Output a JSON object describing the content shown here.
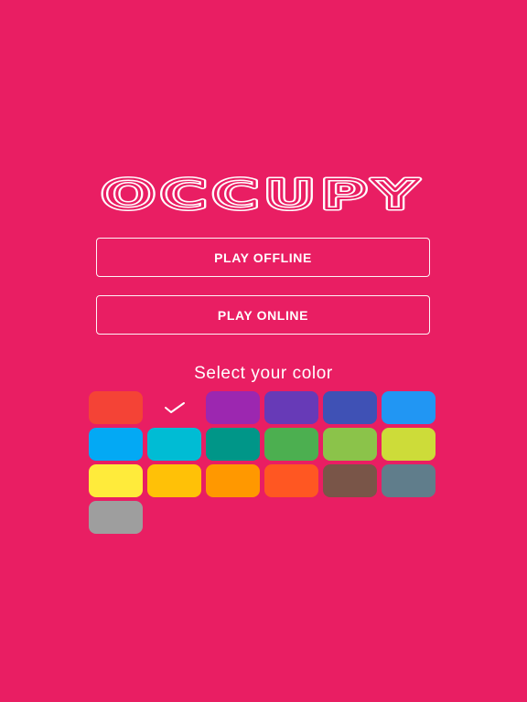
{
  "app": {
    "title": "OCCUPY",
    "background_color": "#E91E63"
  },
  "menu": {
    "play_offline_label": "PLAY OFFLINE",
    "play_online_label": "PLAY ONLINE"
  },
  "color_picker": {
    "label": "Select your color",
    "selected_index": 1,
    "selected_icon": "check-icon",
    "swatches": [
      {
        "name": "red",
        "color": "#F44336"
      },
      {
        "name": "pink",
        "color": "#E91E63"
      },
      {
        "name": "purple",
        "color": "#9C27B0"
      },
      {
        "name": "deep-purple",
        "color": "#673AB7"
      },
      {
        "name": "indigo",
        "color": "#3F51B5"
      },
      {
        "name": "blue",
        "color": "#2196F3"
      },
      {
        "name": "light-blue",
        "color": "#03A9F4"
      },
      {
        "name": "cyan",
        "color": "#00BCD4"
      },
      {
        "name": "teal",
        "color": "#009688"
      },
      {
        "name": "green",
        "color": "#4CAF50"
      },
      {
        "name": "light-green",
        "color": "#8BC34A"
      },
      {
        "name": "lime",
        "color": "#CDDC39"
      },
      {
        "name": "yellow",
        "color": "#FFEB3B"
      },
      {
        "name": "amber",
        "color": "#FFC107"
      },
      {
        "name": "orange",
        "color": "#FF9800"
      },
      {
        "name": "deep-orange",
        "color": "#FF5722"
      },
      {
        "name": "brown",
        "color": "#795548"
      },
      {
        "name": "blue-grey",
        "color": "#607D8B"
      },
      {
        "name": "grey",
        "color": "#9E9E9E"
      }
    ]
  }
}
